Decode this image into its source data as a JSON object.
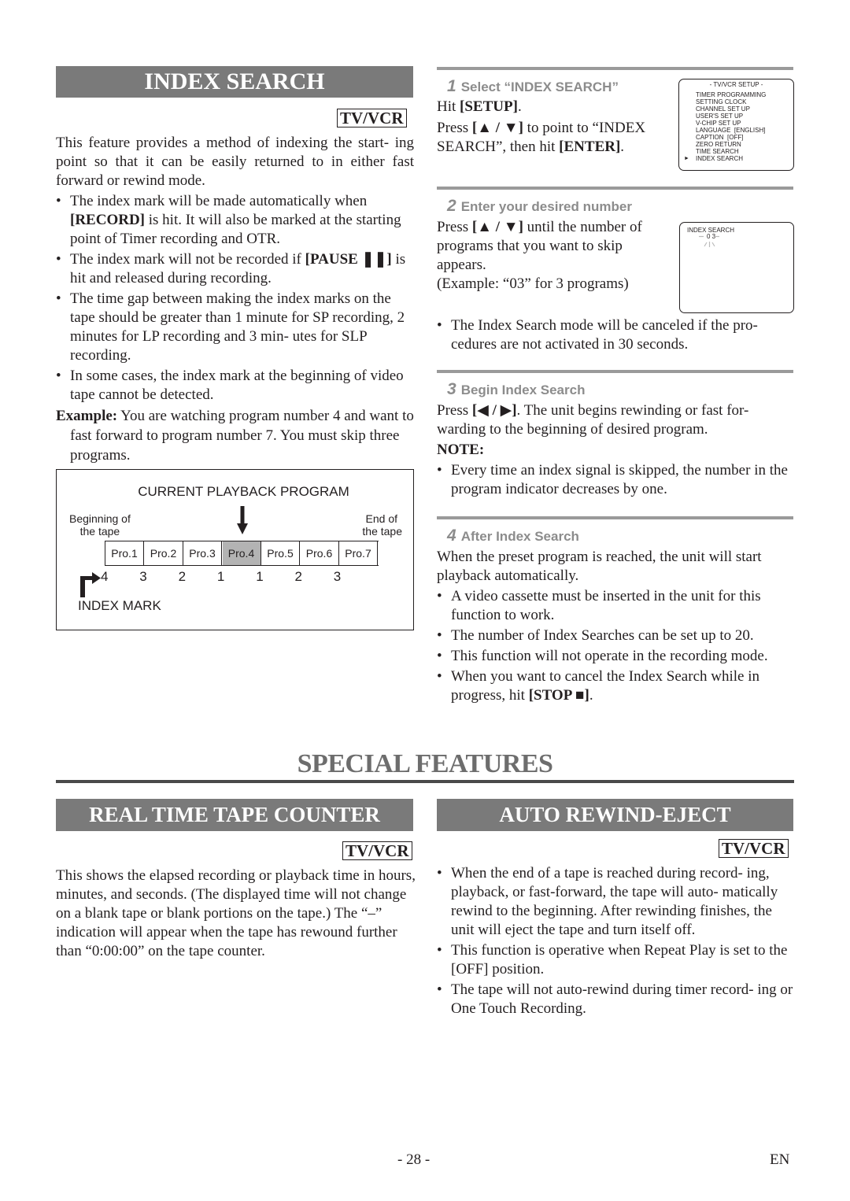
{
  "index_search": {
    "title": "INDEX SEARCH",
    "badge": "TV/VCR",
    "intro": "This feature provides a method of indexing the start- ing point so that it can be easily returned to in either fast forward or rewind mode.",
    "bullets": [
      {
        "pre": "The index mark will be made automatically when ",
        "bold": "[RECORD]",
        "post": " is hit. It will also be marked at the starting point of Timer recording and OTR."
      },
      {
        "pre": "The index mark will not be recorded if ",
        "bold": "[PAUSE ❚❚]",
        "post": " is hit and released during recording."
      },
      {
        "pre": "The time gap between making the index marks on the tape should be greater than 1 minute for SP recording, 2 minutes for LP recording and 3 min- utes for SLP recording.",
        "bold": "",
        "post": ""
      },
      {
        "pre": "In some cases, the index mark at the beginning of video tape cannot be detected.",
        "bold": "",
        "post": ""
      }
    ],
    "example_label": "Example:",
    "example_text": " You are watching program number 4 and want to fast forward to program number 7. You must skip three programs.",
    "diagram": {
      "title": "CURRENT PLAYBACK PROGRAM",
      "beginning_label_1": "Beginning of",
      "beginning_label_2": "the tape",
      "end_label_1": "End of",
      "end_label_2": "the tape",
      "programs": [
        "Pro.1",
        "Pro.2",
        "Pro.3",
        "Pro.4",
        "Pro.5",
        "Pro.6",
        "Pro.7"
      ],
      "current_program_index": 3,
      "index_numbers": [
        "4",
        "3",
        "2",
        "1",
        "1",
        "2",
        "3"
      ],
      "index_mark_label": "INDEX MARK"
    }
  },
  "steps": [
    {
      "num": "1",
      "title": "Select “INDEX SEARCH”",
      "line1_pre": "Hit ",
      "line1_bold": "[SETUP]",
      "line1_post": ".",
      "line2_pre": "Press ",
      "line2_bold": "[▲ / ▼]",
      "line2_mid": " to point to “INDEX SEARCH”, then hit ",
      "line2_bold2": "[ENTER]",
      "line2_post": ".",
      "screen": {
        "header": "- TV/VCR SETUP -",
        "items": [
          "TIMER PROGRAMMING",
          "SETTING CLOCK",
          "CHANNEL SET UP",
          "USER'S SET UP",
          "V-CHIP SET UP",
          "LANGUAGE  [ENGLISH]",
          "CAPTION  [OFF]",
          "ZERO RETURN",
          "TIME SEARCH",
          "INDEX SEARCH"
        ],
        "selected_index": 9,
        "cursor": "►"
      }
    },
    {
      "num": "2",
      "title": "Enter your desired number",
      "text_pre": "Press ",
      "text_bold": "[▲ / ▼]",
      "text_post": " until the number of programs that you want to skip appears.",
      "example": "(Example: “03” for 3 programs)",
      "screen": {
        "label": "INDEX SEARCH",
        "value": "0 3"
      },
      "bullet": "The Index Search mode will be canceled if the pro- cedures are not activated in 30 seconds."
    },
    {
      "num": "3",
      "title": "Begin Index Search",
      "text_pre": "Press ",
      "text_bold": "[◀ / ▶]",
      "text_post": ". The unit begins rewinding or fast for- warding to the beginning of desired program.",
      "note_label": "NOTE:",
      "bullet": "Every time an index signal is skipped, the number in the program indicator decreases by one."
    },
    {
      "num": "4",
      "title": "After Index Search",
      "text": "When the preset program is reached, the unit will start playback automatically.",
      "bullets": [
        {
          "pre": "A video cassette must be inserted in the unit for this function to work.",
          "bold": "",
          "post": ""
        },
        {
          "pre": "The number of Index Searches can be set up to 20.",
          "bold": "",
          "post": ""
        },
        {
          "pre": "This function will not operate in the recording mode.",
          "bold": "",
          "post": ""
        },
        {
          "pre": "When you want to cancel the Index Search while in progress, hit ",
          "bold": "[STOP ■]",
          "post": "."
        }
      ]
    }
  ],
  "special_features": {
    "title": "SPECIAL FEATURES"
  },
  "real_time_counter": {
    "title": "REAL TIME TAPE COUNTER",
    "badge": "TV/VCR",
    "text": "This shows the elapsed recording or playback time in hours, minutes, and seconds. (The displayed time will not change on a blank tape or blank portions on the tape.) The “–” indication will appear when the tape has rewound further than “0:00:00” on the tape counter."
  },
  "auto_rewind": {
    "title": "AUTO REWIND-EJECT",
    "badge": "TV/VCR",
    "bullets": [
      "When the end of a tape is reached during record- ing, playback, or fast-forward, the tape will auto- matically rewind to the beginning. After rewinding finishes, the unit will eject the tape and turn itself off.",
      "This function is operative when Repeat Play is set to the [OFF] position.",
      "The tape will not auto-rewind during timer record- ing or One Touch Recording."
    ]
  },
  "footer": {
    "page": "- 28 -",
    "lang": "EN"
  },
  "colors": {
    "title_bar": "#7a7a7a",
    "step_heading": "#8c8c8c",
    "current_program": "#b3b3b3"
  }
}
